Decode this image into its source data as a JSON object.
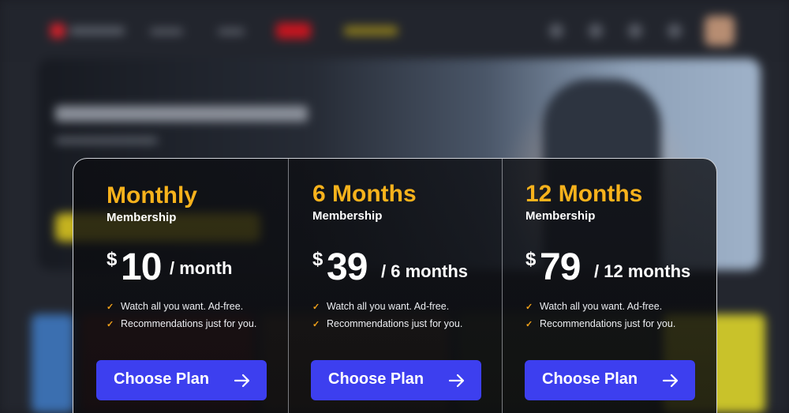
{
  "colors": {
    "accent_gold": "#f7b21c",
    "button_blue": "#3d3fef",
    "check_orange": "#f2a21a",
    "panel_border": "#cfd2d8"
  },
  "plans": [
    {
      "title": "Monthly",
      "subtitle": "Membership",
      "currency": "$",
      "amount": "10",
      "period": "/ month",
      "features": [
        "Watch all you want. Ad-free.",
        "Recommendations just for you."
      ],
      "button_label": "Choose Plan",
      "button_icon": "arrow-right-icon"
    },
    {
      "title": "6 Months",
      "subtitle": "Membership",
      "currency": "$",
      "amount": "39",
      "period": "/ 6 months",
      "features": [
        "Watch all you want. Ad-free.",
        "Recommendations just for you."
      ],
      "button_label": "Choose Plan",
      "button_icon": "arrow-right-icon"
    },
    {
      "title": "12 Months",
      "subtitle": "Membership",
      "currency": "$",
      "amount": "79",
      "period": "/ 12 months",
      "features": [
        "Watch all you want. Ad-free.",
        "Recommendations just for you."
      ],
      "button_label": "Choose Plan",
      "button_icon": "arrow-right-icon"
    }
  ],
  "feature_icon": "check-icon",
  "background": {
    "header_icons": [
      "search-icon",
      "bell-icon",
      "gift-icon",
      "settings-icon",
      "avatar"
    ]
  }
}
